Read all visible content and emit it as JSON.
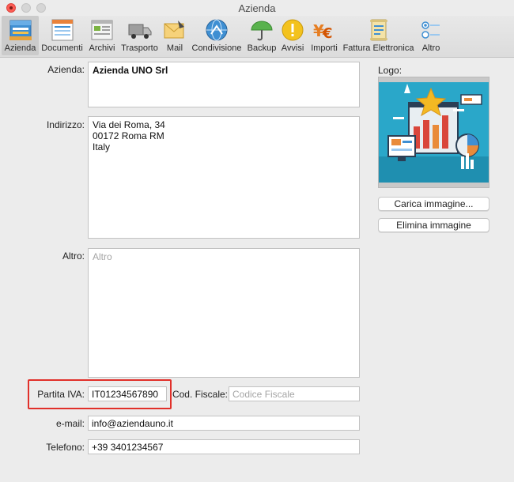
{
  "window": {
    "title": "Azienda"
  },
  "toolbar": {
    "items": [
      {
        "label": "Azienda",
        "icon": "company-tray-icon"
      },
      {
        "label": "Documenti",
        "icon": "document-icon"
      },
      {
        "label": "Archivi",
        "icon": "archive-icon"
      },
      {
        "label": "Trasporto",
        "icon": "truck-icon"
      },
      {
        "label": "Mail",
        "icon": "mail-icon"
      },
      {
        "label": "Condivisione",
        "icon": "network-globe-icon"
      },
      {
        "label": "Backup",
        "icon": "umbrella-icon"
      },
      {
        "label": "Avvisi",
        "icon": "warning-icon"
      },
      {
        "label": "Importi",
        "icon": "currency-icon"
      },
      {
        "label": "Fattura Elettronica",
        "icon": "scroll-icon"
      },
      {
        "label": "Altro",
        "icon": "radio-options-icon"
      }
    ],
    "selected": "Azienda"
  },
  "form": {
    "azienda": {
      "label": "Azienda:",
      "value": "Azienda UNO Srl"
    },
    "indirizzo": {
      "label": "Indirizzo:",
      "lines": [
        "Via dei Roma, 34",
        "00172 Roma RM",
        "Italy"
      ]
    },
    "altro": {
      "label": "Altro:",
      "placeholder": "Altro"
    },
    "partita_iva": {
      "label": "Partita IVA:",
      "value": "IT01234567890"
    },
    "cod_fiscale": {
      "label": "Cod. Fiscale:",
      "placeholder": "Codice Fiscale"
    },
    "email": {
      "label": "e-mail:",
      "value": "info@aziendauno.it"
    },
    "telefono": {
      "label": "Telefono:",
      "value": "+39 3401234567"
    }
  },
  "logo": {
    "label": "Logo:",
    "upload_label": "Carica immagine...",
    "delete_label": "Elimina immagine"
  },
  "colors": {
    "highlight": "#e1302a",
    "logo_bg": "#2aa7c9"
  }
}
